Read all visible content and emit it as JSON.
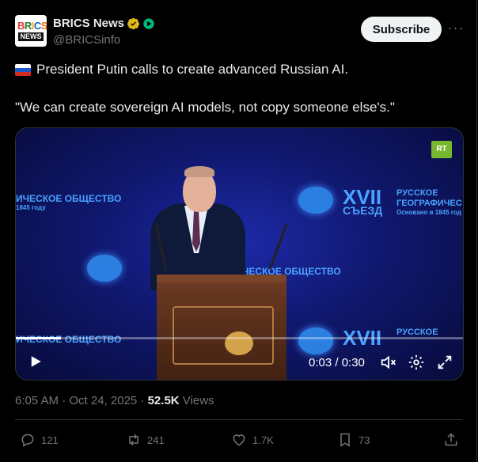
{
  "author": {
    "name": "BRICS News",
    "handle": "@BRICSinfo",
    "avatar_text_top": "BRICS",
    "avatar_text_bottom": "NEWS"
  },
  "actions": {
    "subscribe_label": "Subscribe",
    "more_label": "···"
  },
  "tweet": {
    "line1": "President Putin calls to create advanced Russian AI.",
    "line2": "\"We can create sovereign AI models, not copy someone else's.\""
  },
  "video": {
    "channel_badge": "RT",
    "wall_text_1": "ИЧЕСКОЕ ОБЩЕСТВО",
    "wall_text_2": "1845 году",
    "wall_numeral": "XVII",
    "wall_word": "СЪЕЗД",
    "wall_right_1": "РУССКОЕ",
    "wall_right_2": "ГЕОГРАФИЧЕС",
    "wall_right_3": "Основано в 1845 год",
    "wall_mid": "ЧЕСКОЕ ОБЩЕСТВО",
    "time_display": "0:03 / 0:30",
    "progress": 0.1
  },
  "meta": {
    "timestamp": "6:05 AM · Oct 24, 2025 · ",
    "views_count": "52.5K",
    "views_label": " Views"
  },
  "engagement": {
    "replies": "121",
    "reposts": "241",
    "likes": "1.7K",
    "bookmarks": "73"
  },
  "colors": {
    "background": "#000000",
    "text": "#e7e9ea",
    "muted": "#71767b",
    "verified_gold": "#e2b719",
    "affiliate_green": "#00ba7c"
  }
}
